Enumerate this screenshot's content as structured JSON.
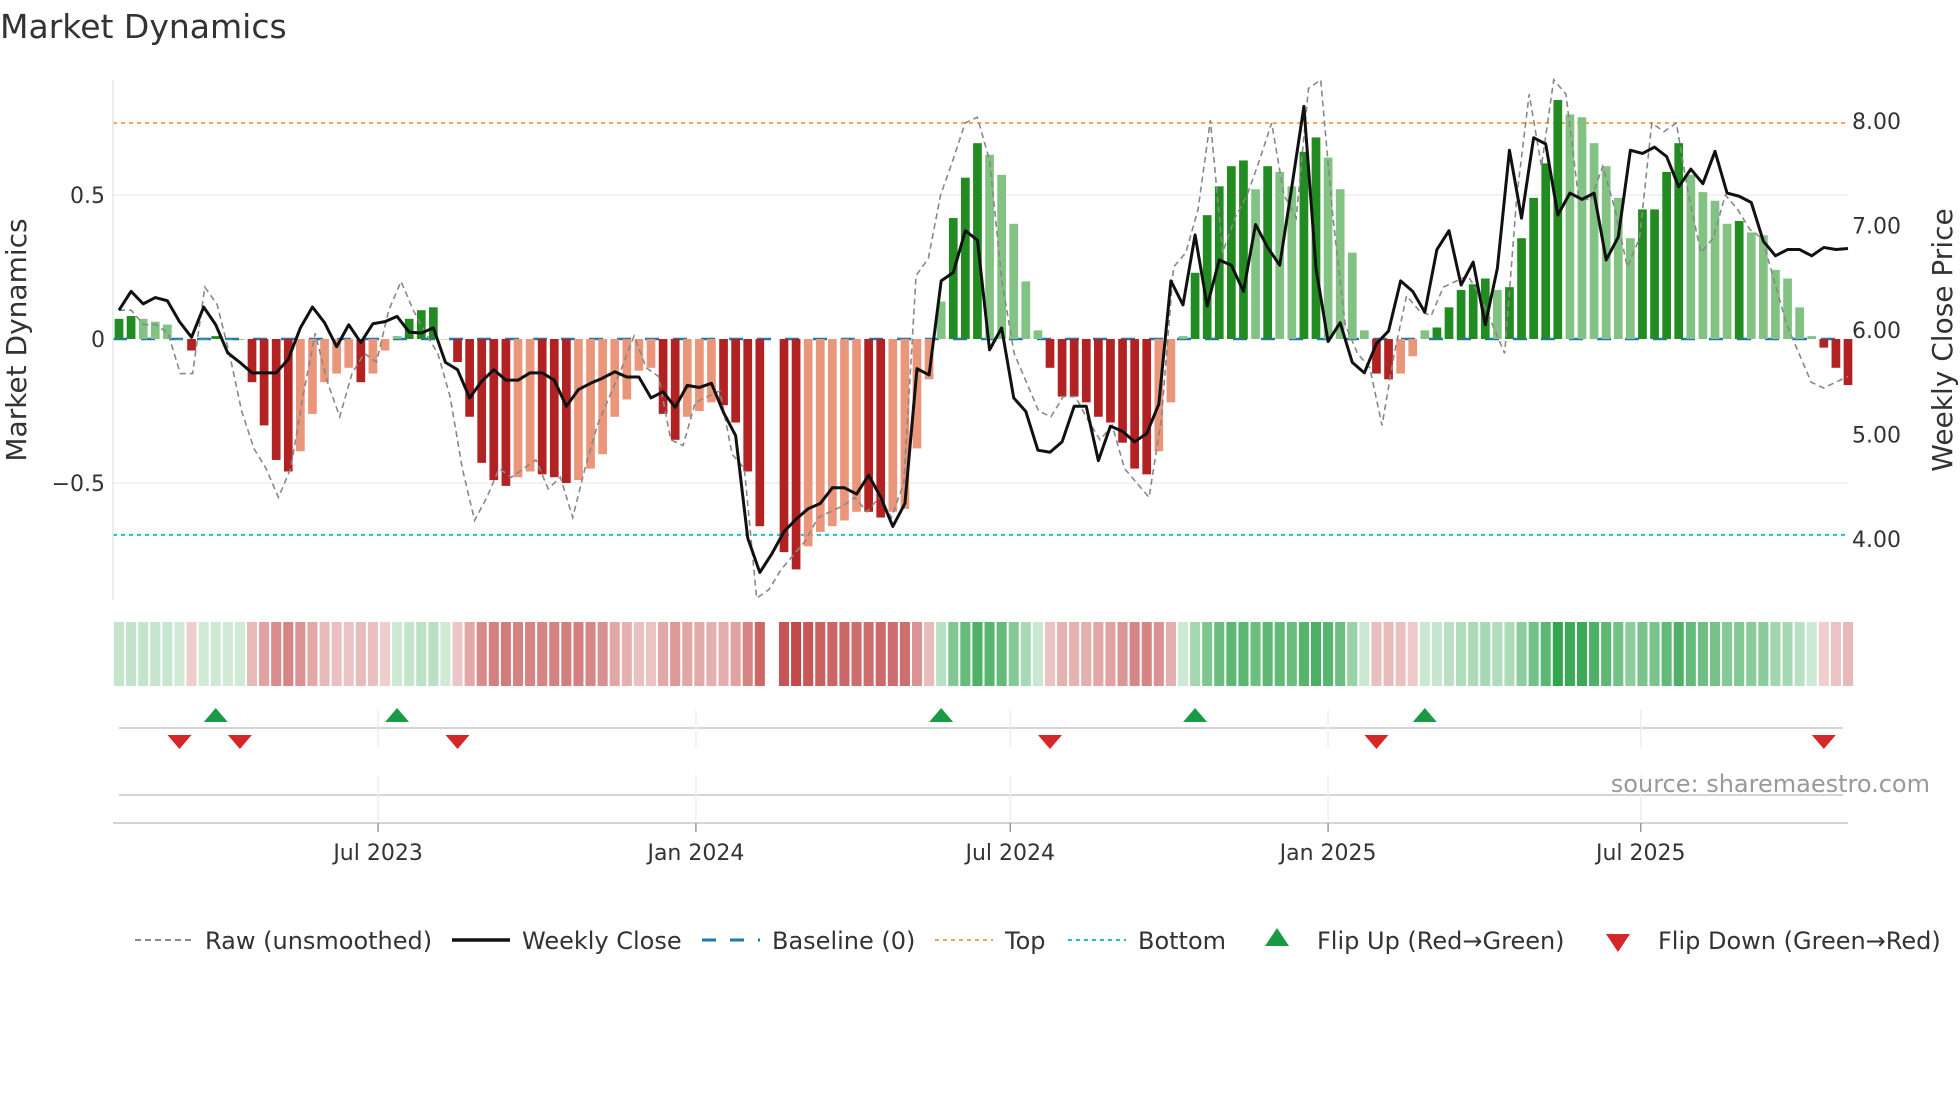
{
  "title": "Market Dynamics",
  "source": "source: sharemaestro.com",
  "colors": {
    "strong_green": "#228b22",
    "weak_green": "#82c282",
    "strong_red": "#b22222",
    "weak_red": "#e9967a",
    "raw": "#888888",
    "close": "#111111",
    "baseline": "#1f77b4",
    "top": "#f4a460",
    "bottom": "#17becf",
    "flip_up": "#1a9a45",
    "flip_down": "#d62728"
  },
  "chart_data": {
    "type": "bar",
    "start_date": "2023-02-01",
    "interval_days": 7,
    "left_axis": {
      "label": "Market Dynamics",
      "ylim": [
        -0.92,
        0.9
      ],
      "ticks": [
        0.5,
        0,
        -0.5
      ],
      "tick_labels": [
        "0.5",
        "0",
        "−0.5"
      ]
    },
    "right_axis": {
      "label": "Weekly Close Price",
      "ylim": [
        3.5,
        8.4
      ],
      "ticks": [
        8,
        7,
        6,
        5,
        4
      ],
      "tick_labels": [
        "8.00",
        "7.00",
        "6.00",
        "5.00",
        "4.00"
      ]
    },
    "x_ticks": [
      {
        "date": "2023-07-01",
        "label": "Jul 2023"
      },
      {
        "date": "2024-01-01",
        "label": "Jan 2024"
      },
      {
        "date": "2024-07-01",
        "label": "Jul 2024"
      },
      {
        "date": "2025-01-01",
        "label": "Jan 2025"
      },
      {
        "date": "2025-07-01",
        "label": "Jul 2025"
      }
    ],
    "top_level": 0.75,
    "bottom_level": -0.68,
    "baseline": 0,
    "dynamics": [
      0.07,
      0.08,
      0.07,
      0.06,
      0.05,
      0,
      -0.04,
      0,
      0.01,
      0,
      0,
      -0.15,
      -0.3,
      -0.42,
      -0.46,
      -0.39,
      -0.26,
      -0.15,
      -0.12,
      -0.1,
      -0.15,
      -0.12,
      -0.04,
      0.01,
      0.07,
      0.1,
      0.11,
      0,
      -0.08,
      -0.27,
      -0.43,
      -0.49,
      -0.51,
      -0.48,
      -0.46,
      -0.47,
      -0.48,
      -0.5,
      -0.49,
      -0.45,
      -0.4,
      -0.27,
      -0.21,
      -0.11,
      -0.1,
      -0.26,
      -0.35,
      -0.27,
      -0.25,
      -0.22,
      -0.23,
      -0.29,
      -0.46,
      -0.65,
      null,
      -0.74,
      -0.8,
      -0.72,
      -0.67,
      -0.65,
      -0.63,
      -0.6,
      -0.6,
      -0.62,
      -0.6,
      -0.59,
      -0.38,
      -0.14,
      0.13,
      0.42,
      0.56,
      0.68,
      0.64,
      0.57,
      0.4,
      0.2,
      0.03,
      -0.1,
      -0.2,
      -0.2,
      -0.22,
      -0.27,
      -0.29,
      -0.36,
      -0.45,
      -0.47,
      -0.39,
      -0.22,
      0.01,
      0.23,
      0.43,
      0.53,
      0.6,
      0.62,
      0.52,
      0.6,
      0.58,
      0.53,
      0.65,
      0.7,
      0.63,
      0.52,
      0.3,
      0.03,
      -0.12,
      -0.14,
      -0.12,
      -0.06,
      0.03,
      0.04,
      0.11,
      0.17,
      0.19,
      0.21,
      0.17,
      0.18,
      0.35,
      0.49,
      0.61,
      0.83,
      0.78,
      0.77,
      0.68,
      0.6,
      0.49,
      0.35,
      0.45,
      0.45,
      0.58,
      0.68,
      0.57,
      0.51,
      0.48,
      0.4,
      0.41,
      0.37,
      0.36,
      0.24,
      0.21,
      0.11,
      0.01,
      -0.03,
      -0.1,
      -0.16
    ],
    "weekly_close": [
      6.19,
      6.37,
      6.25,
      6.31,
      6.28,
      6.08,
      5.93,
      6.22,
      6.05,
      5.78,
      5.69,
      5.59,
      5.59,
      5.59,
      5.72,
      6.02,
      6.22,
      6.07,
      5.84,
      6.05,
      5.88,
      6.06,
      6.08,
      6.13,
      5.98,
      5.97,
      6.02,
      5.69,
      5.62,
      5.35,
      5.51,
      5.62,
      5.52,
      5.52,
      5.59,
      5.59,
      5.52,
      5.27,
      5.43,
      5.49,
      5.54,
      5.6,
      5.55,
      5.55,
      5.35,
      5.41,
      5.26,
      5.47,
      5.45,
      5.49,
      5.21,
      4.99,
      4.01,
      3.68,
      3.86,
      4.07,
      4.19,
      4.29,
      4.34,
      4.49,
      4.49,
      4.43,
      4.61,
      4.4,
      4.12,
      4.34,
      5.63,
      5.57,
      6.47,
      6.55,
      6.95,
      6.86,
      5.81,
      6.02,
      5.35,
      5.22,
      4.85,
      4.83,
      4.93,
      5.27,
      5.27,
      4.75,
      5.08,
      5.03,
      4.93,
      5.01,
      5.29,
      6.47,
      6.24,
      6.91,
      6.23,
      6.67,
      6.62,
      6.37,
      7.01,
      6.79,
      6.62,
      7.37,
      8.14,
      6.59,
      5.89,
      6.07,
      5.69,
      5.59,
      5.87,
      5.99,
      6.47,
      6.37,
      6.17,
      6.77,
      6.95,
      6.43,
      6.65,
      6.05,
      6.59,
      7.72,
      7.07,
      7.84,
      7.78,
      7.1,
      7.31,
      7.25,
      7.31,
      6.67,
      6.89,
      7.72,
      7.69,
      7.75,
      7.66,
      7.37,
      7.54,
      7.4,
      7.71,
      7.31,
      7.28,
      7.22,
      6.85,
      6.71,
      6.77,
      6.77,
      6.71,
      6.79,
      6.77,
      6.78
    ],
    "raw": [
      0.1,
      0.1,
      0.05,
      0.05,
      0.02,
      -0.12,
      -0.12,
      0.18,
      0.12,
      -0.05,
      -0.25,
      -0.38,
      -0.45,
      -0.55,
      -0.45,
      -0.2,
      0.02,
      -0.15,
      -0.27,
      -0.12,
      -0.05,
      -0.08,
      0.1,
      0.2,
      0.1,
      0.02,
      -0.05,
      -0.2,
      -0.45,
      -0.63,
      -0.55,
      -0.45,
      -0.48,
      -0.45,
      -0.42,
      -0.52,
      -0.48,
      -0.62,
      -0.45,
      -0.3,
      -0.2,
      -0.1,
      0.01,
      -0.1,
      -0.13,
      -0.35,
      -0.37,
      -0.22,
      -0.2,
      -0.18,
      -0.4,
      -0.45,
      -0.9,
      -0.87,
      -0.8,
      -0.75,
      -0.7,
      -0.62,
      -0.6,
      -0.58,
      -0.55,
      -0.6,
      -0.55,
      -0.62,
      -0.5,
      0.22,
      0.28,
      0.5,
      0.62,
      0.75,
      0.77,
      0.62,
      0.2,
      -0.05,
      -0.15,
      -0.25,
      -0.27,
      -0.2,
      -0.2,
      -0.28,
      -0.35,
      -0.3,
      -0.45,
      -0.5,
      -0.55,
      -0.28,
      0.25,
      0.3,
      0.45,
      0.76,
      0.3,
      0.42,
      0.5,
      0.62,
      0.75,
      0.5,
      0.42,
      0.87,
      0.9,
      0.42,
      0.05,
      -0.05,
      -0.1,
      -0.3,
      -0.05,
      0.15,
      0.1,
      0.08,
      0.18,
      0.2,
      0.22,
      0.15,
      0.05,
      -0.05,
      0.5,
      0.85,
      0.6,
      0.9,
      0.85,
      0.5,
      0.48,
      0.6,
      0.45,
      0.25,
      0.35,
      0.75,
      0.72,
      0.75,
      0.5,
      0.3,
      0.35,
      0.5,
      0.45,
      0.38,
      0.35,
      0.2,
      0.05,
      -0.05,
      -0.15,
      -0.17,
      -0.15,
      -0.13
    ],
    "flip_up_weeks": [
      8,
      23,
      68,
      89,
      108
    ],
    "flip_down_weeks": [
      5,
      10,
      28,
      77,
      104,
      141
    ],
    "legend": {
      "position": "bottom",
      "items": [
        {
          "label": "Raw (unsmoothed)",
          "kind": "raw"
        },
        {
          "label": "Weekly Close",
          "kind": "close"
        },
        {
          "label": "Baseline (0)",
          "kind": "baseline"
        },
        {
          "label": "Top",
          "kind": "top"
        },
        {
          "label": "Bottom",
          "kind": "bottom"
        },
        {
          "label": "Flip Up (Red→Green)",
          "kind": "up"
        },
        {
          "label": "Flip Down (Green→Red)",
          "kind": "down"
        }
      ]
    }
  }
}
